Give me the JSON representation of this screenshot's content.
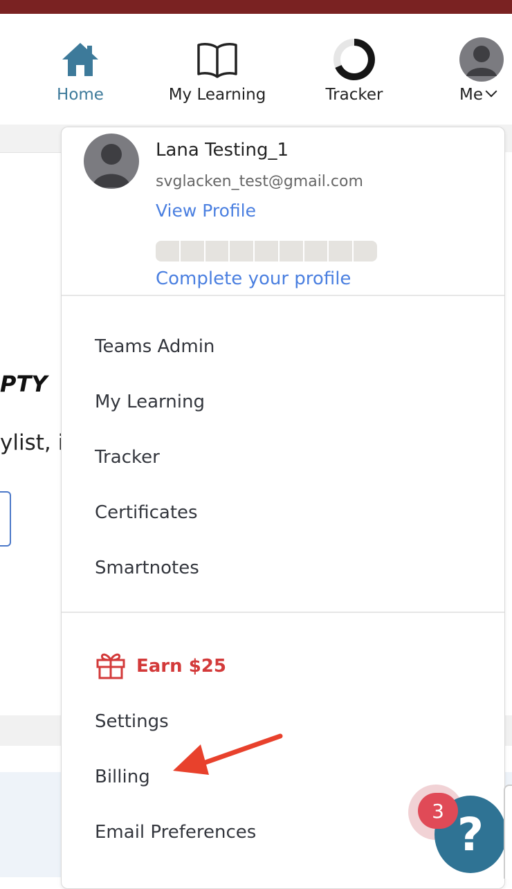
{
  "nav": {
    "items": [
      {
        "label": "Home",
        "icon": "home-icon",
        "active": true
      },
      {
        "label": "My Learning",
        "icon": "book-icon",
        "active": false
      },
      {
        "label": "Tracker",
        "icon": "tracker-ring-icon",
        "active": false
      },
      {
        "label": "Me",
        "icon": "avatar",
        "active": false
      }
    ]
  },
  "background": {
    "empty_heading_fragment": "PTY",
    "playlist_fragment": "ylist, it"
  },
  "profile": {
    "name": "Lana Testing_1",
    "email": "svglacken_test@gmail.com",
    "view_profile": "View Profile",
    "complete_profile": "Complete your profile",
    "progress_segments_filled": 0,
    "progress_segments_total": 9
  },
  "menu": {
    "primary": [
      "Teams Admin",
      "My Learning",
      "Tracker",
      "Certificates",
      "Smartnotes"
    ],
    "earn_label": "Earn $25",
    "secondary": [
      "Settings",
      "Billing",
      "Email Preferences"
    ]
  },
  "help": {
    "badge_count": "3",
    "symbol": "?"
  },
  "colors": {
    "topbar": "#7a2222",
    "accent_home": "#3d7a9a",
    "link_blue": "#4a7fe0",
    "earn_red": "#d33a3a",
    "help_blue": "#2f7394",
    "badge_red": "#e04a57",
    "annotation_arrow": "#e8412c"
  }
}
